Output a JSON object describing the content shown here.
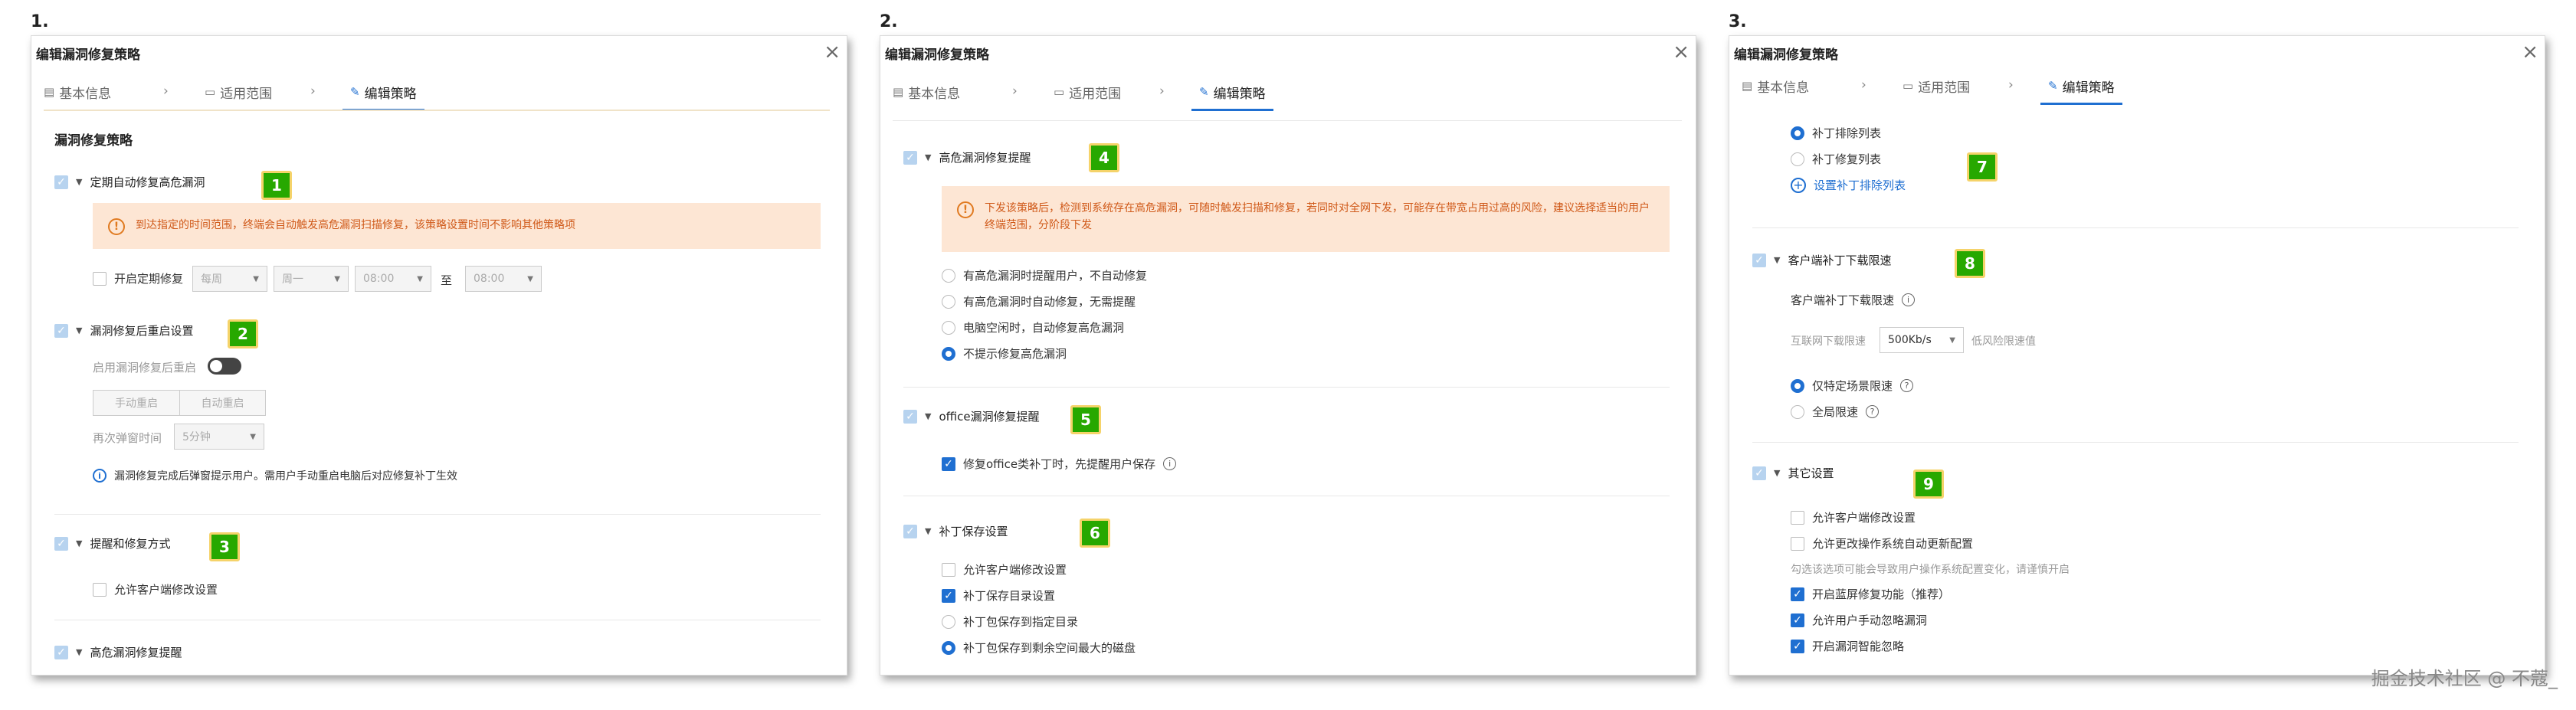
{
  "steps": [
    "1.",
    "2.",
    "3."
  ],
  "dialog": {
    "title": "编辑漏洞修复策略",
    "tabs": [
      "基本信息",
      "适用范围",
      "编辑策略"
    ],
    "tab_separator": "›"
  },
  "panel1": {
    "heading": "漏洞修复策略",
    "s1": {
      "title": "定期自动修复高危漏洞",
      "badge": "1",
      "warning": "到达指定的时间范围，终端会自动触发高危漏洞扫描修复，该策略设置时间不影响其他策略项",
      "enable_label": "开启定期修复",
      "freq": "每周",
      "day": "周一",
      "start": "08:00",
      "to": "至",
      "end": "08:00"
    },
    "s2": {
      "title": "漏洞修复后重启设置",
      "badge": "2",
      "enable_label": "启用漏洞修复后重启",
      "seg_manual": "手动重启",
      "seg_auto": "自动重启",
      "popup_label": "再次弹窗时间",
      "popup_value": "5分钟",
      "info": "漏洞修复完成后弹窗提示用户。需用户手动重启电脑后对应修复补丁生效"
    },
    "s3": {
      "title": "提醒和修复方式",
      "badge": "3",
      "opt": "允许客户端修改设置"
    },
    "s4": {
      "title": "高危漏洞修复提醒"
    }
  },
  "panel2": {
    "s4": {
      "title": "高危漏洞修复提醒",
      "badge": "4",
      "warning": "下发该策略后，检测到系统存在高危漏洞，可随时触发扫描和修复，若同时对全网下发，可能存在带宽占用过高的风险，建议选择适当的用户终端范围，分阶段下发",
      "options": [
        "有高危漏洞时提醒用户，不自动修复",
        "有高危漏洞时自动修复，无需提醒",
        "电脑空闲时，自动修复高危漏洞",
        "不提示修复高危漏洞"
      ]
    },
    "s5": {
      "title": "office漏洞修复提醒",
      "badge": "5",
      "opt": "修复office类补丁时，先提醒用户保存"
    },
    "s6": {
      "title": "补丁保存设置",
      "badge": "6",
      "opt1": "允许客户端修改设置",
      "opt2": "补丁保存目录设置",
      "radio1": "补丁包保存到指定目录",
      "radio2": "补丁包保存到剩余空间最大的磁盘"
    }
  },
  "panel3": {
    "s7": {
      "badge": "7",
      "radio1": "补丁排除列表",
      "radio2": "补丁修复列表",
      "link": "设置补丁排除列表"
    },
    "s8": {
      "title": "客户端补丁下载限速",
      "badge": "8",
      "sub": "客户端补丁下载限速",
      "net_label": "互联网下载限速",
      "net_value": "500Kb/s",
      "low_label": "低风险限速值",
      "radio1": "仅特定场景限速",
      "radio2": "全局限速"
    },
    "s9": {
      "title": "其它设置",
      "badge": "9",
      "opt1": "允许客户端修改设置",
      "opt2": "允许更改操作系统自动更新配置",
      "hint": "勾选该选项可能会导致用户操作系统配置变化，请谨慎开启",
      "opt3": "开启蓝屏修复功能（推荐）",
      "opt4": "允许用户手动忽略漏洞",
      "opt5": "开启漏洞智能忽略"
    }
  },
  "watermark": "掘金技术社区 @ 不蔻_"
}
